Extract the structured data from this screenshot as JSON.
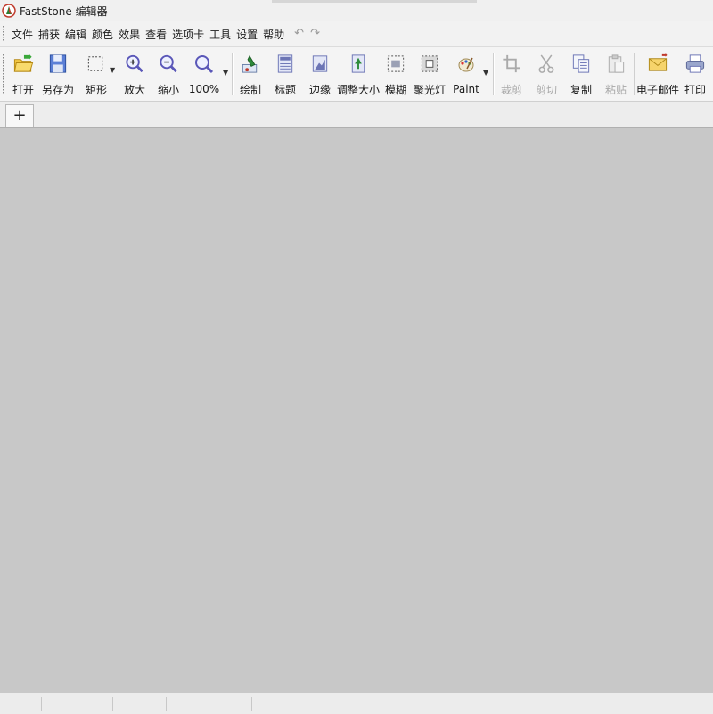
{
  "window": {
    "title": "FastStone 编辑器"
  },
  "menu": {
    "items": [
      "文件",
      "捕获",
      "编辑",
      "颜色",
      "效果",
      "查看",
      "选项卡",
      "工具",
      "设置",
      "帮助"
    ]
  },
  "toolbar": {
    "open": "打开",
    "save_as": "另存为",
    "rect": "矩形",
    "zoom_in": "放大",
    "zoom_out": "缩小",
    "zoom_level": "100%",
    "draw": "绘制",
    "caption": "标题",
    "edge": "边缘",
    "resize": "调整大小",
    "blur": "模糊",
    "spotlight": "聚光灯",
    "paint": "Paint",
    "crop": "裁剪",
    "cut": "剪切",
    "copy": "复制",
    "paste": "粘贴",
    "email": "电子邮件",
    "print": "打印"
  },
  "tabs": {
    "add_label": "+"
  },
  "colors": {
    "canvas": "#c8c8c8",
    "disabled_text": "#a8a8a8"
  }
}
